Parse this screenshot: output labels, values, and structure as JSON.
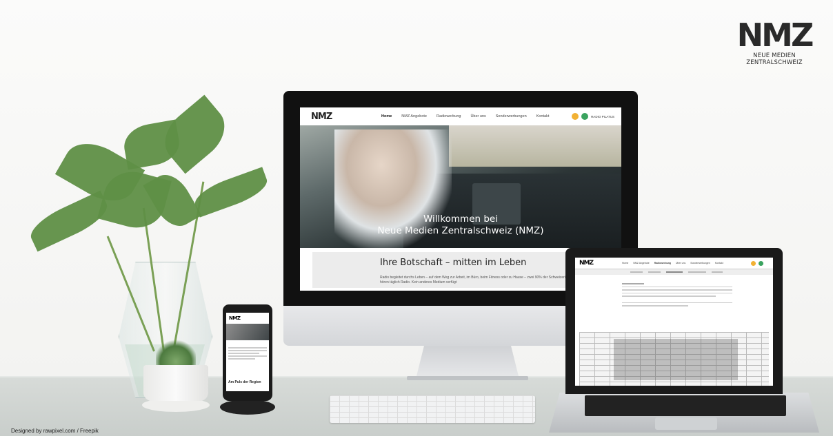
{
  "brand": {
    "mark": "NMZ",
    "tagline": "NEUE MEDIEN ZENTRALSCHWEIZ"
  },
  "imac": {
    "nav": {
      "logo": "NMZ",
      "items": [
        "Home",
        "NMZ Angebote",
        "Radiowerbung",
        "Über uns",
        "Sonderwerbungen",
        "Kontakt"
      ],
      "partners": "RADIO PILATUS"
    },
    "hero_title_line1": "Willkommen bei",
    "hero_title_line2": "Neue Medien Zentralschweiz (NMZ)",
    "section_heading": "Ihre Botschaft – mitten im Leben",
    "section_text": "Radio begleitet durchs Leben – auf dem Weg zur Arbeit, im Büro, beim Fitness oder zu Hause – zwei 90% der Schweizerinnen und Schweizer hören täglich Radio. Kein anderes Medium verfügt"
  },
  "laptop": {
    "nav": {
      "logo": "NMZ",
      "items": [
        "Home",
        "NMZ Angebote",
        "Radiowerbung",
        "Über uns",
        "Sonderwerbungen",
        "Kontakt"
      ]
    }
  },
  "phone": {
    "logo": "NMZ",
    "heading": "Am Puls der Region"
  },
  "credit": "Designed by rawpixel.com / Freepik"
}
